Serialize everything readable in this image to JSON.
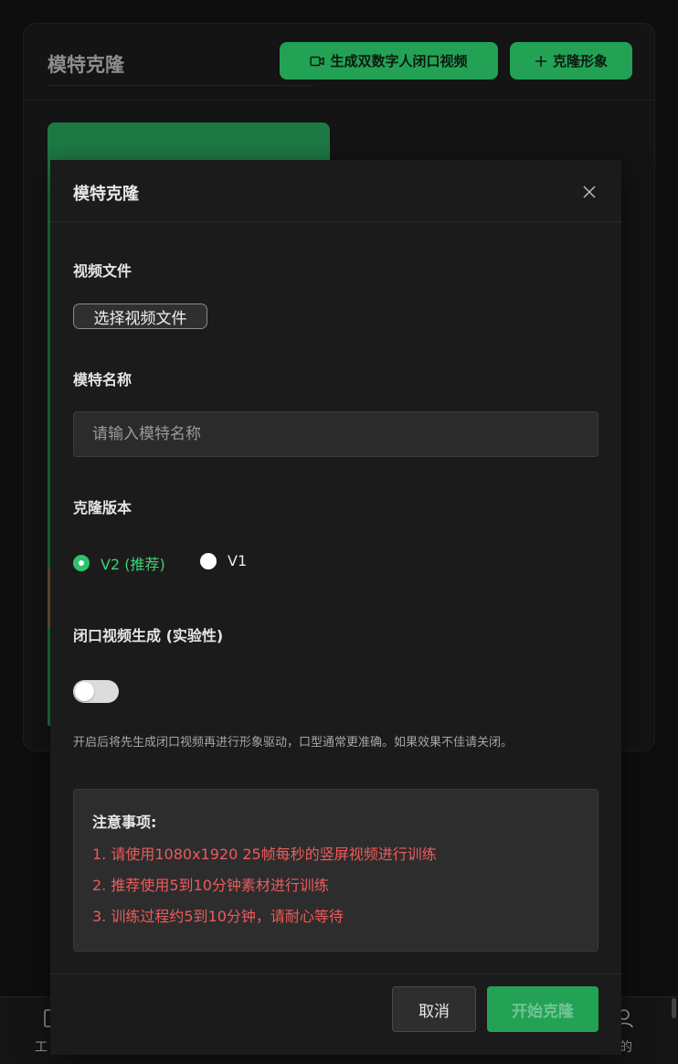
{
  "background": {
    "title": "模特克隆",
    "generate_button": "生成双数字人闭口视频",
    "clone_button": "克隆形象",
    "nav": {
      "left_label": "工",
      "right_label": "的"
    }
  },
  "modal": {
    "title": "模特克隆",
    "video_file": {
      "label": "视频文件",
      "button": "选择视频文件"
    },
    "model_name": {
      "label": "模特名称",
      "value": "",
      "placeholder": "请输入模特名称"
    },
    "clone_version": {
      "label": "克隆版本",
      "options": [
        {
          "label": "V2 (推荐)",
          "selected": true
        },
        {
          "label": "V1",
          "selected": false
        }
      ]
    },
    "closed_mouth": {
      "label": "闭口视频生成 (实验性)",
      "enabled": false,
      "hint": "开启后将先生成闭口视频再进行形象驱动，口型通常更准确。如果效果不佳请关闭。"
    },
    "notice": {
      "title": "注意事项:",
      "items": [
        "1. 请使用1080x1920 25帧每秒的竖屏视频进行训练",
        "2. 推荐使用5到10分钟素材进行训练",
        "3. 训练过程约5到10分钟，请耐心等待"
      ]
    },
    "footer": {
      "cancel": "取消",
      "start": "开始克隆"
    }
  },
  "colors": {
    "accent": "#23a255",
    "selected_radio_text": "#3fd07a",
    "notice_text": "#ee5a5a",
    "modal_bg": "#1b1b1b"
  },
  "icons": [
    "video-camera-icon",
    "plus-icon",
    "close-icon",
    "nav-device-icon",
    "nav-user-icon"
  ]
}
